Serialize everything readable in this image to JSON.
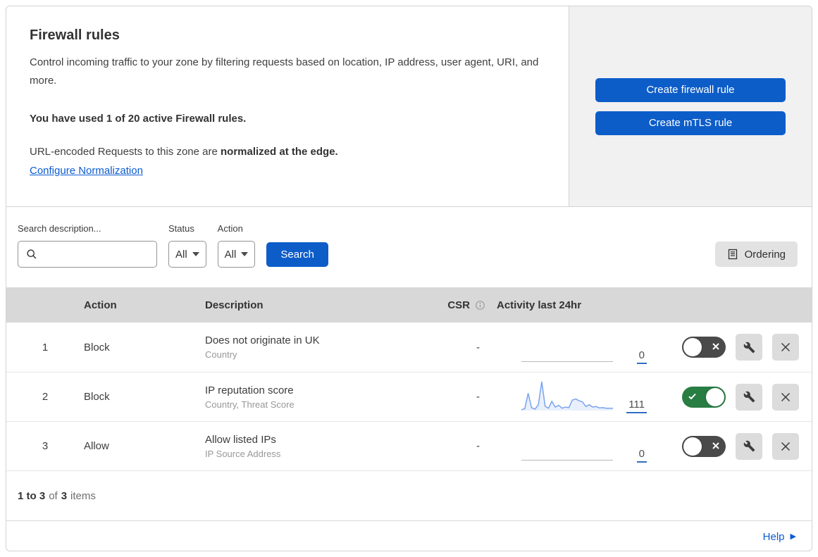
{
  "header": {
    "title": "Firewall rules",
    "description": "Control incoming traffic to your zone by filtering requests based on location, IP address, user agent, URI, and more.",
    "usage": "You have used 1 of 20 active Firewall rules.",
    "normalization_prefix": "URL-encoded Requests to this zone are ",
    "normalization_bold": "normalized at the edge.",
    "normalization_link": "Configure Normalization",
    "create_firewall_button": "Create firewall rule",
    "create_mtls_button": "Create mTLS rule"
  },
  "filters": {
    "search_label": "Search description...",
    "status_label": "Status",
    "status_value": "All",
    "action_label": "Action",
    "action_value": "All",
    "search_button": "Search",
    "ordering_button": "Ordering"
  },
  "table": {
    "headers": {
      "action": "Action",
      "description": "Description",
      "csr": "CSR",
      "activity": "Activity last 24hr"
    },
    "rows": [
      {
        "priority": "1",
        "action": "Block",
        "description": "Does not originate in UK",
        "fields": "Country",
        "csr": "-",
        "activity_count": "0",
        "enabled": false
      },
      {
        "priority": "2",
        "action": "Block",
        "description": "IP reputation score",
        "fields": "Country, Threat Score",
        "csr": "-",
        "activity_count": "111",
        "enabled": true,
        "sparkline": [
          3,
          6,
          60,
          10,
          5,
          20,
          100,
          15,
          8,
          32,
          12,
          18,
          8,
          12,
          10,
          36,
          40,
          34,
          30,
          14,
          20,
          12,
          14,
          9,
          10,
          8,
          8,
          8
        ]
      },
      {
        "priority": "3",
        "action": "Allow",
        "description": "Allow listed IPs",
        "fields": "IP Source Address",
        "csr": "-",
        "activity_count": "0",
        "enabled": false
      }
    ]
  },
  "footer": {
    "range": "1 to 3",
    "of": "of",
    "total": "3",
    "items": "items"
  },
  "help": {
    "label": "Help"
  },
  "colors": {
    "accent_blue": "#0d5dc9",
    "link_blue": "#0b5bd0",
    "toggle_on_green": "#287d43",
    "toggle_off_gray": "#4a4a4a",
    "sparkline_blue": "#79a3ee",
    "table_header_bg": "#d8d8d8",
    "side_panel_bg": "#f1f1f1"
  }
}
